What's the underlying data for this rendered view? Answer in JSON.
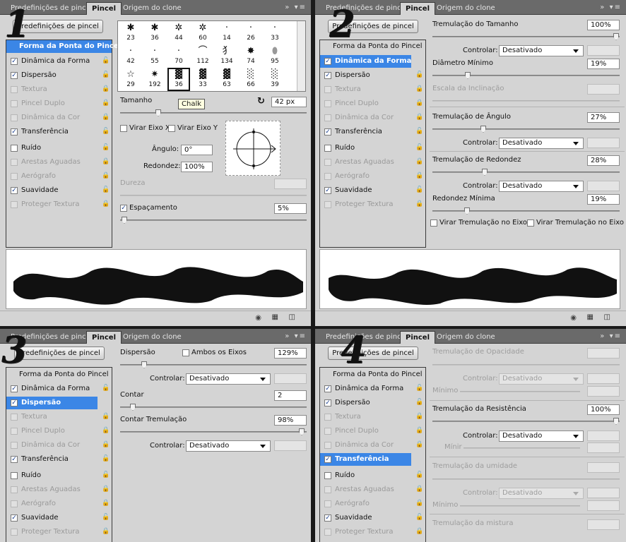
{
  "tabs": {
    "presets": "Predefinições de pincel",
    "brush": "Pincel",
    "clone": "Origem do clone"
  },
  "icons": {
    "panel_menu": "»  ▾≡",
    "lock": "lock-icon"
  },
  "panel_numbers": [
    "1",
    "2",
    "3",
    "4"
  ],
  "preset_button": "Predefinições de pincel",
  "sidebar": {
    "header": "Forma da Ponta do Pincel",
    "items": [
      "Dinâmica da Forma",
      "Dispersão",
      "Textura",
      "Pincel Duplo",
      "Dinâmica da Cor",
      "Transferência",
      "Ruído",
      "Arestas Aguadas",
      "Aerógrafo",
      "Suavidade",
      "Proteger Textura"
    ]
  },
  "panel1": {
    "brushes": [
      [
        "23",
        "36",
        "44",
        "60",
        "14",
        "26",
        "33"
      ],
      [
        "42",
        "55",
        "70",
        "112",
        "134",
        "74",
        "95"
      ],
      [
        "29",
        "192",
        "36",
        "33",
        "63",
        "66",
        "39"
      ]
    ],
    "tooltip": "Chalk",
    "size_label": "Tamanho",
    "size_value": "42 px",
    "flip_x": "Virar Eixo X",
    "flip_y": "Virar Eixo Y",
    "angle_label": "Ângulo:",
    "angle_value": "0°",
    "round_label": "Redondez:",
    "round_value": "100%",
    "hardness_label": "Dureza",
    "spacing_label": "Espaçamento",
    "spacing_value": "5%"
  },
  "panel2": {
    "size_jitter_label": "Tremulação do Tamanho",
    "size_jitter_value": "100%",
    "control_label": "Controlar:",
    "control_value": "Desativado",
    "min_diam_label": "Diâmetro Mínimo",
    "min_diam_value": "19%",
    "tilt_label": "Escala da Inclinação",
    "angle_jitter_label": "Tremulação de Ângulo",
    "angle_jitter_value": "27%",
    "round_jitter_label": "Tremulação de Redondez",
    "round_jitter_value": "28%",
    "min_round_label": "Redondez Mínima",
    "min_round_value": "19%",
    "flip_x_jitter": "Virar Tremulação no Eixo X",
    "flip_y_jitter": "Virar Tremulação no Eixo Y"
  },
  "panel3": {
    "scatter_label": "Dispersão",
    "both_axes": "Ambos os Eixos",
    "scatter_value": "129%",
    "control_label": "Controlar:",
    "control_value": "Desativado",
    "count_label": "Contar",
    "count_value": "2",
    "count_jitter_label": "Contar Tremulação",
    "count_jitter_value": "98%"
  },
  "panel4": {
    "opacity_jitter_label": "Tremulação de Opacidade",
    "control_label": "Controlar:",
    "control_value": "Desativado",
    "minimum_label": "Mínimo",
    "flow_jitter_label": "Tremulação da Resistência",
    "flow_jitter_value": "100%",
    "min_short": "Mínir",
    "wetness_jitter_label": "Tremulação da umidade",
    "mix_jitter_label": "Tremulação da mistura"
  }
}
